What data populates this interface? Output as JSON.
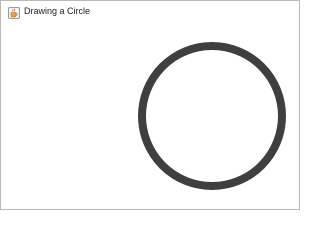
{
  "window": {
    "title": "Drawing a Circle",
    "icon": "java-cup-icon"
  },
  "drawing": {
    "shape": "circle",
    "stroke_color": "#3f3f3f",
    "fill": "none",
    "background_color": "#ffffff"
  }
}
